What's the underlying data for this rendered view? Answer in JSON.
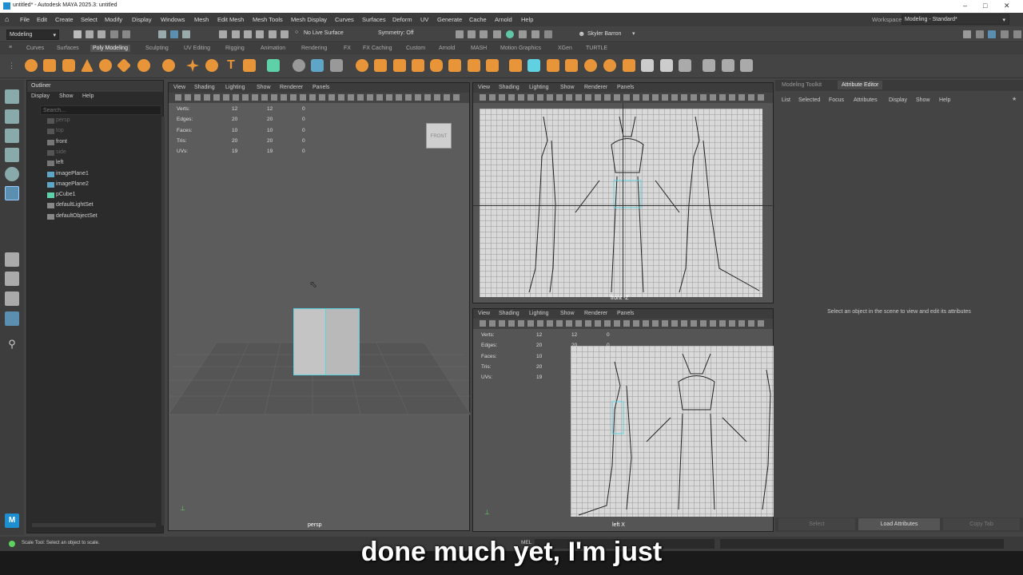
{
  "window": {
    "title": "untitled* - Autodesk MAYA 2025.3: untitled"
  },
  "menubar": [
    "File",
    "Edit",
    "Create",
    "Select",
    "Modify",
    "Display",
    "Windows",
    "Mesh",
    "Edit Mesh",
    "Mesh Tools",
    "Mesh Display",
    "Curves",
    "Surfaces",
    "Deform",
    "UV",
    "Generate",
    "Cache",
    "Arnold",
    "Help"
  ],
  "workspace": {
    "label": "Workspace:",
    "value": "Modeling - Standard*"
  },
  "statusline": {
    "mode": "Modeling",
    "live_surface": "No Live Surface",
    "symmetry": "Symmetry: Off",
    "user": "Skyler Barron"
  },
  "shelf_tabs": [
    "Curves",
    "Surfaces",
    "Poly Modeling",
    "Sculpting",
    "UV Editing",
    "Rigging",
    "Animation",
    "Rendering",
    "FX",
    "FX Caching",
    "Custom",
    "Arnold",
    "MASH",
    "Motion Graphics",
    "XGen",
    "TURTLE"
  ],
  "shelf_active": "Poly Modeling",
  "outliner": {
    "title": "Outliner",
    "menu": [
      "Display",
      "Show",
      "Help"
    ],
    "search_placeholder": "Search...",
    "items": [
      {
        "label": "persp",
        "dim": true
      },
      {
        "label": "top",
        "dim": true
      },
      {
        "label": "front",
        "dim": false
      },
      {
        "label": "side",
        "dim": true
      },
      {
        "label": "left",
        "dim": false
      },
      {
        "label": "imagePlane1",
        "dim": false
      },
      {
        "label": "imagePlane2",
        "dim": false
      },
      {
        "label": "pCube1",
        "dim": false
      },
      {
        "label": "defaultLightSet",
        "dim": false
      },
      {
        "label": "defaultObjectSet",
        "dim": false
      }
    ]
  },
  "viewport_menu": [
    "View",
    "Shading",
    "Lighting",
    "Show",
    "Renderer",
    "Panels"
  ],
  "hud": {
    "labels": [
      "Verts:",
      "Edges:",
      "Faces:",
      "Tris:",
      "UVs:"
    ],
    "persp": [
      [
        "12",
        "12",
        "0"
      ],
      [
        "20",
        "20",
        "0"
      ],
      [
        "10",
        "10",
        "0"
      ],
      [
        "20",
        "20",
        "0"
      ],
      [
        "19",
        "19",
        "0"
      ]
    ],
    "side": [
      [
        "12",
        "12",
        "0"
      ],
      [
        "20",
        "20",
        "0"
      ],
      [
        "10",
        "10",
        "0"
      ],
      [
        "20",
        "20",
        "0"
      ],
      [
        "19",
        "19",
        "0"
      ]
    ]
  },
  "viewports": {
    "persp_label": "persp",
    "front_label": "front -Z",
    "side_label": "left X",
    "viewcube": "FRONT"
  },
  "attribute_editor": {
    "tabs": [
      "Modeling Toolkit",
      "Attribute Editor"
    ],
    "menu": [
      "List",
      "Selected",
      "Focus",
      "Attributes",
      "Display",
      "Show",
      "Help"
    ],
    "message": "Select an object in the scene to view and edit its attributes",
    "buttons": [
      "Select",
      "Load Attributes",
      "Copy Tab"
    ]
  },
  "helpline": "Scale Tool: Select an object to scale.",
  "cmd_label": "MEL",
  "caption": "done much yet, I'm just",
  "colors": {
    "accent_orange": "#e8953a",
    "selection_cyan": "#5fd1e0",
    "maya_blue": "#1d8fd1"
  }
}
